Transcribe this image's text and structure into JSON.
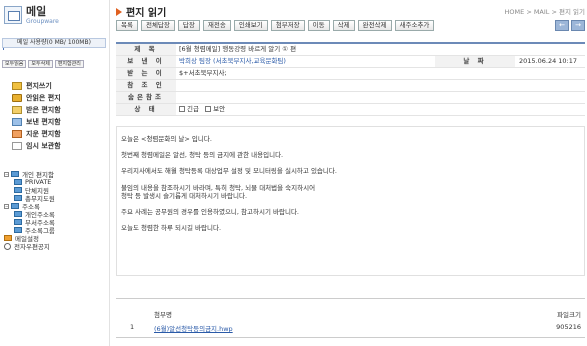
{
  "sidebar": {
    "logo_title": "메일",
    "logo_sub": "Groupware",
    "usage": "메일 사용량(0 MB/ 100MB)",
    "usage_fraction": 0.01,
    "buttons": [
      "모두읽음",
      "모두삭제",
      "편지함관리"
    ],
    "menu": [
      {
        "label": "편지쓰기",
        "icon": "compose-icon"
      },
      {
        "label": "안읽은 편지",
        "icon": "unread-icon"
      },
      {
        "label": "받은 편지함",
        "icon": "inbox-icon"
      },
      {
        "label": "보낸 편지함",
        "icon": "sent-icon"
      },
      {
        "label": "지운 편지함",
        "icon": "trash-icon"
      },
      {
        "label": "임시 보관함",
        "icon": "draft-icon"
      }
    ],
    "tree": [
      {
        "label": "개인 편지함",
        "level": 0,
        "toggle": "−",
        "kind": "folder"
      },
      {
        "label": "PRIVATE",
        "level": 1,
        "kind": "folder"
      },
      {
        "label": "단체지원",
        "level": 1,
        "kind": "folder"
      },
      {
        "label": "총무지도원",
        "level": 1,
        "kind": "folder"
      },
      {
        "label": "주소록",
        "level": 0,
        "toggle": "−",
        "kind": "folder"
      },
      {
        "label": "개인주소록",
        "level": 1,
        "kind": "folder"
      },
      {
        "label": "부서주소록",
        "level": 1,
        "kind": "folder"
      },
      {
        "label": "주소록그룹",
        "level": 1,
        "kind": "folder"
      },
      {
        "label": "메일설정",
        "level": 0,
        "kind": "settings"
      },
      {
        "label": "전자우편공지",
        "level": 0,
        "kind": "notice"
      }
    ]
  },
  "main": {
    "title": "편지 읽기",
    "breadcrumb": "HOME > MAIL > 편지 읽기",
    "toolbar": [
      "목록",
      "전체답장",
      "답장",
      "재전송",
      "인쇄보기",
      "첨부저장",
      "이동",
      "삭제",
      "완전삭제",
      "새주소추가"
    ],
    "nav": [
      "←",
      "→"
    ],
    "header": {
      "subject_label": "제  목",
      "subject": "[6월 청렴메일] 행동강령 바르게 알기 ① 편",
      "from_label": "보 낸 이",
      "from": "박희상 팀장 (서초북부지사,교육문화팀)",
      "date_label": "날 짜",
      "date": "2015.06.24 10:17",
      "to_label": "받 는 이",
      "to": "$+서초북부지사;",
      "cc_label": "참 조 인",
      "cc": "",
      "bcc_label": "숨은참조",
      "bcc": "",
      "status_label": "상  태",
      "status_urgent": "긴급",
      "status_secure": "보안"
    },
    "body": [
      "오늘은 <청렴문화의 날> 입니다.",
      "첫번째 청렴메일은 알선, 청탁 등의 금지에 관한 내용입니다.",
      "우리지사에서도 해월 청탁등록 대상업무 설정 및 모니터링을 실시하고 있습니다.",
      "불임의 내용을 참조하시기 바라며, 특히 청탁, 뇌물 대처법을 숙지하시어\n청탁 등 발생시 슬기롭게 대처하시기 바랍니다.",
      "주요 사례는 공무원의 경우를 인용하였으니, 참고하시기 바랍니다.",
      "오늘도 청렴한 하루 되시길 바랍니다."
    ],
    "attachments": {
      "header_name": "첨부명",
      "header_size": "파일크기",
      "items": [
        {
          "no": "1",
          "name": "(6월)알선청탁등의금지.hwp",
          "size": "905216"
        }
      ]
    }
  }
}
